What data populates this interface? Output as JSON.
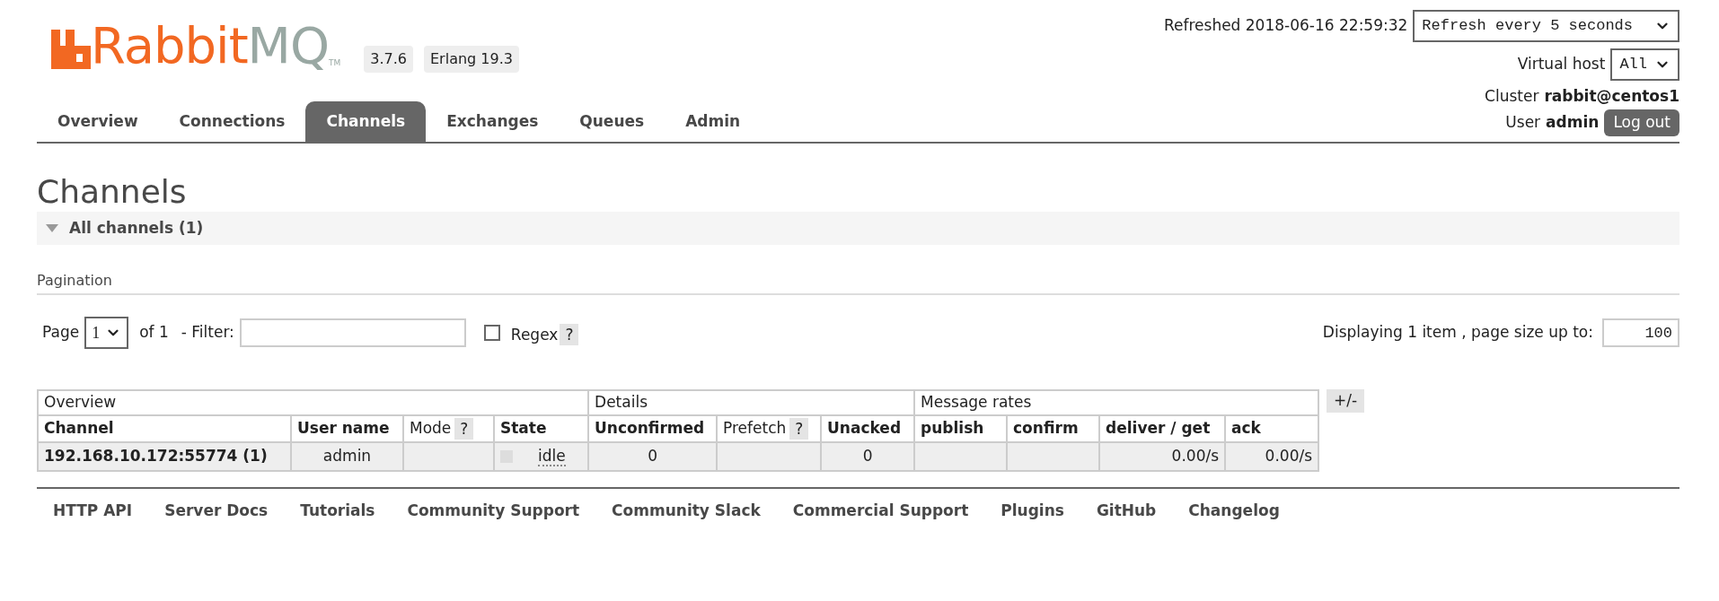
{
  "header": {
    "logo": {
      "primary": "Rabbit",
      "secondary": "MQ",
      "trademark": "TM"
    },
    "version_badges": [
      "3.7.6",
      "Erlang 19.3"
    ],
    "refreshed": "Refreshed 2018-06-16 22:59:32",
    "refresh_select": "Refresh every 5 seconds",
    "vhost_label": "Virtual host",
    "vhost_select": "All",
    "cluster_label": "Cluster",
    "cluster_name": "rabbit@centos1",
    "user_label": "User",
    "user_name": "admin",
    "logout": "Log out"
  },
  "tabs": [
    {
      "label": "Overview",
      "selected": false
    },
    {
      "label": "Connections",
      "selected": false
    },
    {
      "label": "Channels",
      "selected": true
    },
    {
      "label": "Exchanges",
      "selected": false
    },
    {
      "label": "Queues",
      "selected": false
    },
    {
      "label": "Admin",
      "selected": false
    }
  ],
  "page_title": "Channels",
  "section": {
    "title": "All channels (1)",
    "expanded": true
  },
  "pagination": {
    "title": "Pagination",
    "page_label": "Page",
    "page_select": "1",
    "of_label": "of 1",
    "filter_label": "- Filter:",
    "regex_label": "Regex",
    "regex_checked": false,
    "help": "?",
    "displaying": "Displaying 1 item , page size up to:",
    "page_size": "100"
  },
  "table": {
    "groups": [
      {
        "label": "Overview",
        "columns": [
          {
            "label": "Channel"
          },
          {
            "label": "User name"
          },
          {
            "label": "Mode",
            "help": "?"
          },
          {
            "label": "State"
          }
        ]
      },
      {
        "label": "Details",
        "columns": [
          {
            "label": "Unconfirmed"
          },
          {
            "label": "Prefetch",
            "help": "?"
          },
          {
            "label": "Unacked"
          }
        ]
      },
      {
        "label": "Message rates",
        "columns": [
          {
            "label": "publish"
          },
          {
            "label": "confirm"
          },
          {
            "label": "deliver / get"
          },
          {
            "label": "ack"
          }
        ]
      }
    ],
    "rows": [
      {
        "cells": [
          {
            "text": "192.168.10.172:55774 (1)"
          },
          {
            "text": "admin"
          },
          {},
          {
            "kind": "state",
            "text": "idle"
          },
          {
            "text": "0"
          },
          {},
          {
            "text": "0"
          },
          {},
          {},
          {
            "text": "0.00/s"
          },
          {
            "text": "0.00/s"
          }
        ]
      }
    ],
    "toggle_columns": "+/-"
  },
  "footer_links": [
    "HTTP API",
    "Server Docs",
    "Tutorials",
    "Community Support",
    "Community Slack",
    "Commercial Support",
    "Plugins",
    "GitHub",
    "Changelog"
  ]
}
